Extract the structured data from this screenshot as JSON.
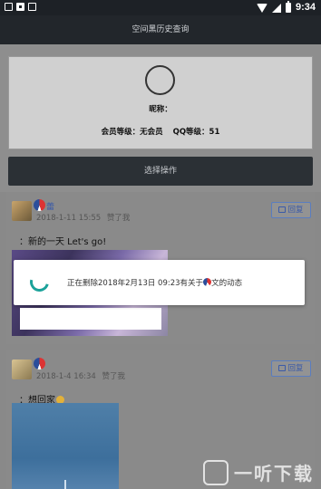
{
  "status_bar": {
    "time": "9:34"
  },
  "app_bar": {
    "title": "空间黑历史查询"
  },
  "profile": {
    "nickname_label": "昵称：",
    "member_level": "会员等级：无会员",
    "qq_level": "QQ等级：51"
  },
  "actions": {
    "select_label": "选择操作"
  },
  "posts": [
    {
      "name": "蕾",
      "date": "2018-1-11 15:55",
      "like_label": "赞了我",
      "reply_label": "回复",
      "text": "：新的一天 Let's go!"
    },
    {
      "name": "",
      "date": "2018-1-4 16:34",
      "like_label": "赞了我",
      "reply_label": "回复",
      "text": "：想回家"
    }
  ],
  "toast": {
    "message_prefix": "正在删除2018年2月13日 09:23有关于",
    "message_suffix": "文的动态"
  },
  "watermark": {
    "text": "一听下载"
  },
  "icons": [
    "wifi-icon",
    "signal-icon",
    "battery-icon",
    "reply-icon",
    "loading-spinner-icon"
  ]
}
